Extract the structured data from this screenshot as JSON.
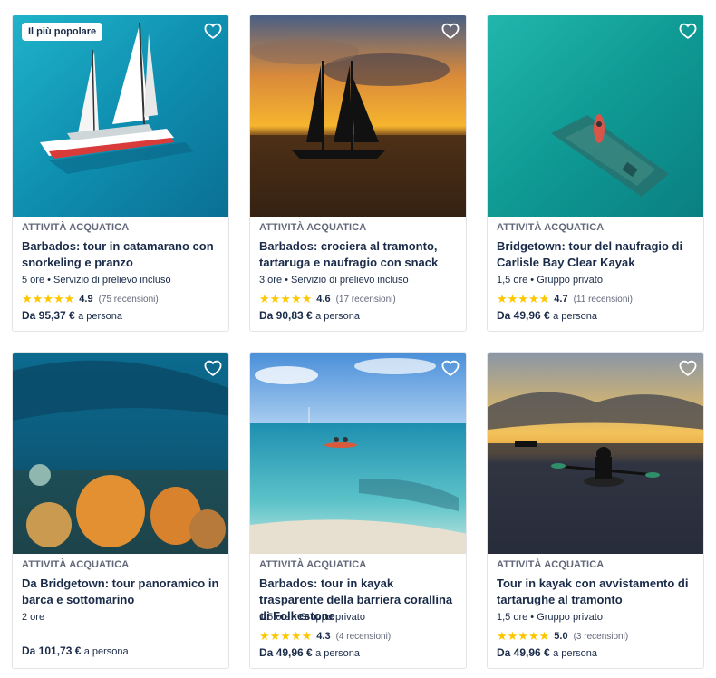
{
  "cards": [
    {
      "badge": "Il più popolare",
      "category": "ATTIVITÀ ACQUATICA",
      "title": "Barbados: tour in catamarano con snorkeling e pranzo",
      "meta": "5 ore • Servizio di prelievo incluso",
      "rating": "4.9",
      "reviews": "(75 recensioni)",
      "stars": 5,
      "price_prefix": "Da 95,37 €",
      "price_suffix": "a persona",
      "icon": "heart-icon"
    },
    {
      "category": "ATTIVITÀ ACQUATICA",
      "title": "Barbados: crociera al tramonto, tartaruga e naufragio con snack",
      "meta": "3 ore • Servizio di prelievo incluso",
      "rating": "4.6",
      "reviews": "(17 recensioni)",
      "stars": 5,
      "price_prefix": "Da 90,83 €",
      "price_suffix": "a persona",
      "icon": "heart-icon"
    },
    {
      "category": "ATTIVITÀ ACQUATICA",
      "title": "Bridgetown: tour del naufragio di Carlisle Bay Clear Kayak",
      "meta": "1,5 ore • Gruppo privato",
      "rating": "4.7",
      "reviews": "(11 recensioni)",
      "stars": 5,
      "price_prefix": "Da 49,96 €",
      "price_suffix": "a persona",
      "icon": "heart-icon"
    },
    {
      "category": "ATTIVITÀ ACQUATICA",
      "title": "Da Bridgetown: tour panoramico in barca e sottomarino",
      "meta": "2 ore",
      "price_prefix": "Da 101,73 €",
      "price_suffix": "a persona",
      "icon": "heart-icon"
    },
    {
      "category": "ATTIVITÀ ACQUATICA",
      "title": "Barbados: tour in kayak trasparente della barriera corallina di Folkestone",
      "meta": "1,5 ore • Gruppo privato",
      "rating": "4.3",
      "reviews": "(4 recensioni)",
      "stars": 5,
      "price_prefix": "Da 49,96 €",
      "price_suffix": "a persona",
      "icon": "heart-icon"
    },
    {
      "category": "ATTIVITÀ ACQUATICA",
      "title": "Tour in kayak con avvistamento di tartarughe al tramonto",
      "meta": "1,5 ore • Gruppo privato",
      "rating": "5.0",
      "reviews": "(3 recensioni)",
      "stars": 5,
      "price_prefix": "Da 49,96 €",
      "price_suffix": "a persona",
      "icon": "heart-icon"
    }
  ],
  "star_color": "#fdc700"
}
